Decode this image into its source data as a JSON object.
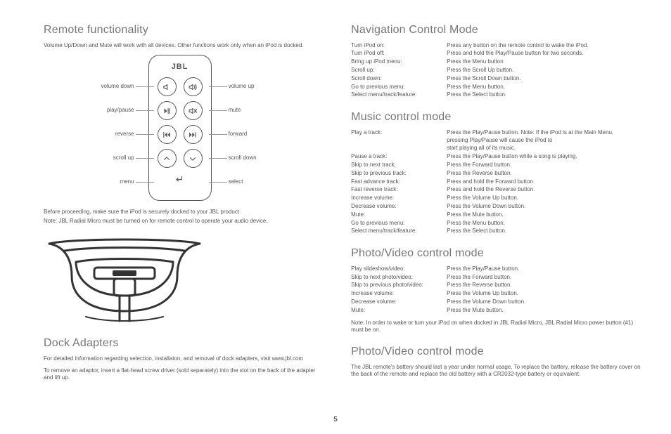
{
  "page_number": "5",
  "left": {
    "remote_heading": "Remote functionality",
    "remote_intro": "Volume Up/Down and Mute will work with all devices.  Other functions work only when an iPod is docked.",
    "remote_labels": {
      "volume_down": "volume down",
      "volume_up": "volume up",
      "play_pause": "play/pause",
      "mute": "mute",
      "reverse": "reverse",
      "forward": "forward",
      "scroll_up": "scroll up",
      "scroll_down": "scroll down",
      "menu": "menu",
      "select": "select"
    },
    "remote_logo": "JBL",
    "before_proceeding_1": "Before proceeding, make sure the iPod is securely docked to your JBL product.",
    "before_proceeding_2": "Note: JBL Radial Micro must be turned on for remote control to operate your audio device.",
    "dock_heading": "Dock Adapters",
    "dock_p1": "For detailed information regarding selection, installaton, and removal of dock adapters, visit www.jbl.com",
    "dock_p2": "To remove an adaptor, insert a flat-head screw driver (sold separately) into the slot on the back of the adapter and lift up."
  },
  "right": {
    "nav_heading": "Navigation Control Mode",
    "nav_rows": [
      {
        "k": "Turn iPod on:",
        "v": "Press any button on the remote control to wake the iPod."
      },
      {
        "k": "Turn iPod off:",
        "v": "Press and hold the Play/Pause button for two seconds."
      },
      {
        "k": "Bring up iPod menu:",
        "v": "Press the Menu button"
      },
      {
        "k": "Scroll up:",
        "v": "Press the Scroll Up button."
      },
      {
        "k": "Scroll down:",
        "v": "Press the Scroll Down button."
      },
      {
        "k": "Go to previous menu:",
        "v": "Press the Menu button."
      },
      {
        "k": "Select menu/track/feature:",
        "v": "Press the Select button."
      }
    ],
    "music_heading": "Music control mode",
    "music_rows": [
      {
        "k": "Play a track:",
        "v": "Press the Play/Pause button. Note: If the iPod is at the Main Menu, pressing Play/Pause will cause the iPod to"
      },
      {
        "k": "",
        "v": "start playing all of its music."
      },
      {
        "k": "Pause a track:",
        "v": "Press the Play/Pause button while a song is playing."
      },
      {
        "k": "Skip to next track:",
        "v": "Press the Forward button."
      },
      {
        "k": "Skip to previous track:",
        "v": "Press the Reverse button."
      },
      {
        "k": "Fast advance track:",
        "v": "Press and hold the Forward button."
      },
      {
        "k": "Fast reverse track:",
        "v": "Press and hold the Reverse button."
      },
      {
        "k": "Increase volume:",
        "v": "Press the Volume Up button."
      },
      {
        "k": "Decrease volume:",
        "v": "Press the Volume Down button."
      },
      {
        "k": "Mute:",
        "v": "Press the Mute button."
      },
      {
        "k": "Go to previous menu:",
        "v": "Press the Menu button."
      },
      {
        "k": "Select menu/track/feature:",
        "v": "Press the Select button."
      }
    ],
    "photo_heading": "Photo/Video control mode",
    "photo_rows": [
      {
        "k": "Play slideshow/video:",
        "v": "Press the Play/Pause button."
      },
      {
        "k": "Skip to next photo/video:",
        "v": "Press the Forward button."
      },
      {
        "k": "Skip to previous photo/video:",
        "v": "Press the Reverse button."
      },
      {
        "k": "Increase volume:",
        "v": "Press the Volume Up button."
      },
      {
        "k": "Decrease volume:",
        "v": "Press the Volume Down button."
      },
      {
        "k": "Mute:",
        "v": "Press the Mute button."
      }
    ],
    "photo_note": "Note:   In order to wake or turn your iPod on when docked in JBL Radial Micro, JBL Radial Micro power button (#1) must be on.",
    "battery_heading": "Photo/Video control mode",
    "battery_text": "The JBL remote's battery should last a year under normal usage. To replace the battery, release the battery cover on the back of the remote and replace the old battery with a CR2032-type battery or equivalent."
  }
}
